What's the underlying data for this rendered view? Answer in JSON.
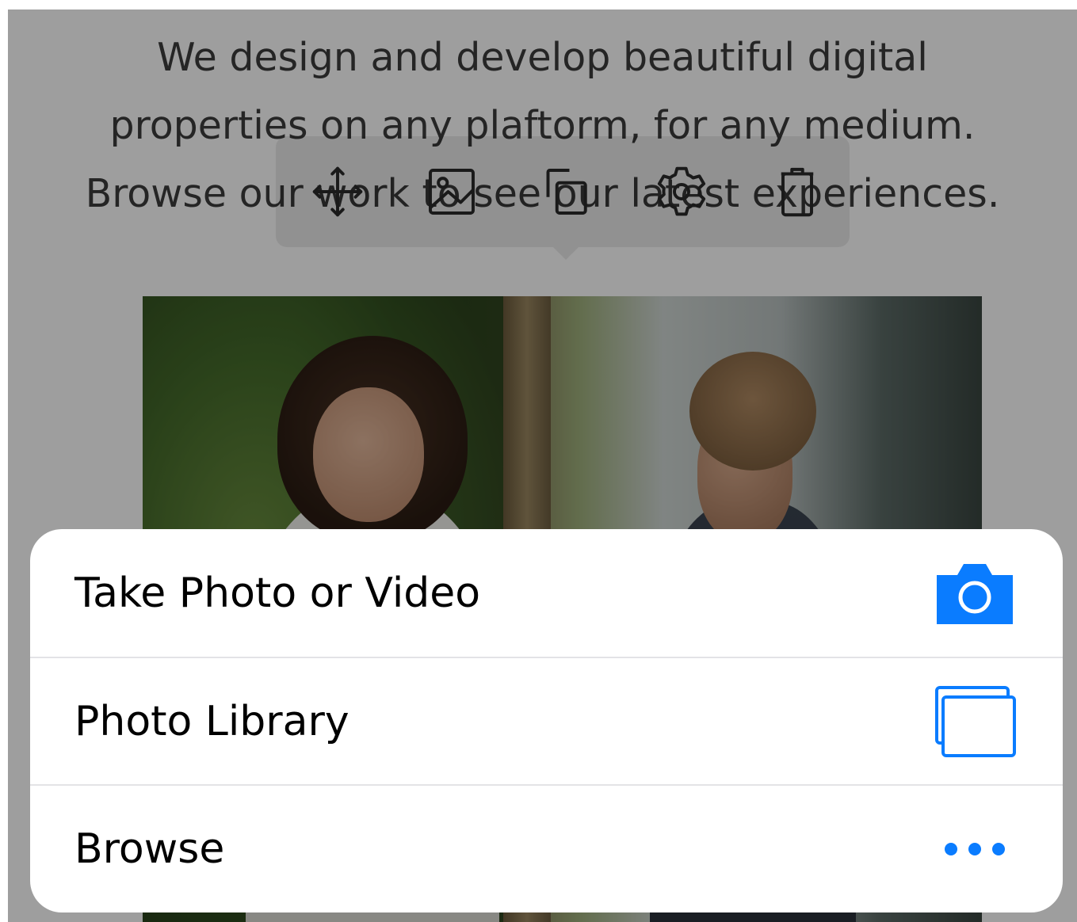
{
  "background": {
    "intro_lines": [
      "We design and develop beautiful digital",
      "properties on any plaftorm, for any medium.",
      "Browse our work to see our latest experiences."
    ]
  },
  "toolbar": {
    "tools": [
      {
        "name": "move-icon"
      },
      {
        "name": "image-icon"
      },
      {
        "name": "duplicate-icon"
      },
      {
        "name": "gear-icon"
      },
      {
        "name": "trash-icon"
      }
    ]
  },
  "action_sheet": {
    "items": [
      {
        "label": "Take Photo or Video",
        "icon": "camera-icon"
      },
      {
        "label": "Photo Library",
        "icon": "photo-library-icon"
      },
      {
        "label": "Browse",
        "icon": "more-icon"
      }
    ],
    "accent_color": "#0a7cff"
  }
}
